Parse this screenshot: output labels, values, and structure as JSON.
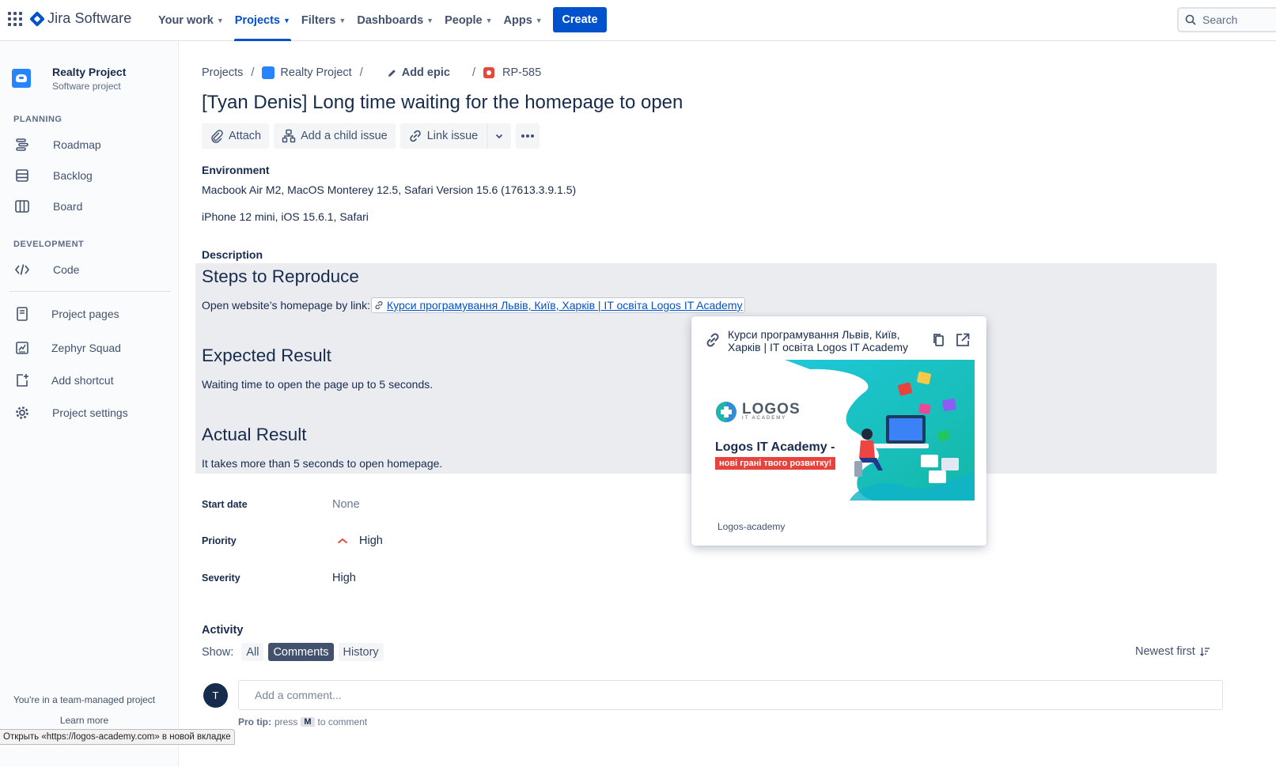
{
  "topnav": {
    "brand": "Jira Software",
    "items": [
      {
        "label": "Your work"
      },
      {
        "label": "Projects"
      },
      {
        "label": "Filters"
      },
      {
        "label": "Dashboards"
      },
      {
        "label": "People"
      },
      {
        "label": "Apps"
      }
    ],
    "create_label": "Create",
    "search_placeholder": "Search"
  },
  "sidebar": {
    "project_name": "Realty Project",
    "project_type": "Software project",
    "planning_label": "PLANNING",
    "development_label": "DEVELOPMENT",
    "items": {
      "roadmap": "Roadmap",
      "backlog": "Backlog",
      "board": "Board",
      "code": "Code",
      "project_pages": "Project pages",
      "zephyr": "Zephyr Squad",
      "add_shortcut": "Add shortcut",
      "settings": "Project settings"
    },
    "team_note": "You're in a team-managed project",
    "learn_more": "Learn more"
  },
  "status_tooltip": "Открыть «https://logos-academy.com» в новой вкладке",
  "breadcrumb": {
    "projects": "Projects",
    "project": "Realty Project",
    "epic": "Add epic",
    "issue_key": "RP-585"
  },
  "issue": {
    "title": "[Tyan Denis] Long time waiting for the homepage to open",
    "actions": {
      "attach": "Attach",
      "child": "Add a child issue",
      "link": "Link issue"
    },
    "environment": {
      "label": "Environment",
      "lines": [
        "Macbook Air M2, MacOS Monterey 12.5, Safari Version 15.6 (17613.3.9.1.5)",
        "iPhone 12 mini, iOS 15.6.1, Safari"
      ]
    },
    "description": {
      "label": "Description",
      "steps_heading": "Steps to Reproduce",
      "steps_text": "Open website’s homepage by link:",
      "link_text": "Курси програмування Львів, Київ, Харків | IT освіта Logos IT Academy",
      "expected_heading": "Expected Result",
      "expected_text": "Waiting time to open the page up to 5 seconds.",
      "actual_heading": "Actual Result",
      "actual_text": "It takes more than 5 seconds to open homepage."
    },
    "fields": {
      "start_date_label": "Start date",
      "start_date_value": "None",
      "priority_label": "Priority",
      "priority_value": "High",
      "severity_label": "Severity",
      "severity_value": "High"
    }
  },
  "activity": {
    "heading": "Activity",
    "show_label": "Show:",
    "filters": [
      "All",
      "Comments",
      "History"
    ],
    "sort_label": "Newest first",
    "avatar_initial": "T",
    "comment_placeholder": "Add a comment...",
    "pro_tip_label": "Pro tip:",
    "pro_tip_press": "press",
    "pro_tip_key": "M",
    "pro_tip_rest": "to comment"
  },
  "link_card": {
    "title": "Курси програмування Львів, Київ, Харків | IT освіта Logos IT Academy",
    "image_logo_word": "LOGOS",
    "image_logo_sub": "IT ACADEMY",
    "image_title": "Logos IT Academy -",
    "image_tagline": "нові грані твого розвитку!",
    "host": "Logos-academy"
  },
  "colors": {
    "brand_blue": "#0052CC",
    "priority_high": "#E5493A",
    "description_bg": "#EBECF0"
  }
}
